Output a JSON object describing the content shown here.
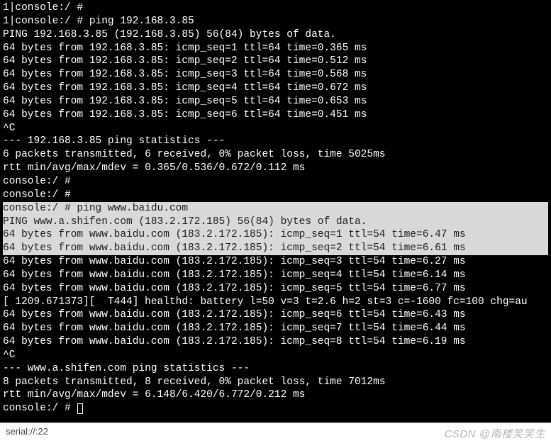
{
  "terminal": {
    "lines": [
      {
        "text": "1|console:/ #",
        "selected": false
      },
      {
        "text": "1|console:/ # ping 192.168.3.85",
        "selected": false
      },
      {
        "text": "PING 192.168.3.85 (192.168.3.85) 56(84) bytes of data.",
        "selected": false
      },
      {
        "text": "64 bytes from 192.168.3.85: icmp_seq=1 ttl=64 time=0.365 ms",
        "selected": false
      },
      {
        "text": "64 bytes from 192.168.3.85: icmp_seq=2 ttl=64 time=0.512 ms",
        "selected": false
      },
      {
        "text": "64 bytes from 192.168.3.85: icmp_seq=3 ttl=64 time=0.568 ms",
        "selected": false
      },
      {
        "text": "64 bytes from 192.168.3.85: icmp_seq=4 ttl=64 time=0.672 ms",
        "selected": false
      },
      {
        "text": "64 bytes from 192.168.3.85: icmp_seq=5 ttl=64 time=0.653 ms",
        "selected": false
      },
      {
        "text": "64 bytes from 192.168.3.85: icmp_seq=6 ttl=64 time=0.451 ms",
        "selected": false
      },
      {
        "text": "^C",
        "selected": false
      },
      {
        "text": "--- 192.168.3.85 ping statistics ---",
        "selected": false
      },
      {
        "text": "6 packets transmitted, 6 received, 0% packet loss, time 5025ms",
        "selected": false
      },
      {
        "text": "rtt min/avg/max/mdev = 0.365/0.536/0.672/0.112 ms",
        "selected": false
      },
      {
        "text": "console:/ #",
        "selected": false
      },
      {
        "text": "console:/ #",
        "selected": false
      },
      {
        "text": "console:/ # ping www.baidu.com",
        "selected": true
      },
      {
        "text": "PING www.a.shifen.com (183.2.172.185) 56(84) bytes of data.",
        "selected": true
      },
      {
        "text": "64 bytes from www.baidu.com (183.2.172.185): icmp_seq=1 ttl=54 time=6.47 ms",
        "selected": true
      },
      {
        "text": "64 bytes from www.baidu.com (183.2.172.185): icmp_seq=2 ttl=54 time=6.61 ms",
        "selected": true
      },
      {
        "text": "64 bytes from www.baidu.com (183.2.172.185): icmp_seq=3 ttl=54 time=6.27 ms",
        "selected": false
      },
      {
        "text": "64 bytes from www.baidu.com (183.2.172.185): icmp_seq=4 ttl=54 time=6.14 ms",
        "selected": false
      },
      {
        "text": "64 bytes from www.baidu.com (183.2.172.185): icmp_seq=5 ttl=54 time=6.77 ms",
        "selected": false
      },
      {
        "text": "[ 1209.671373][  T444] healthd: battery l=50 v=3 t=2.6 h=2 st=3 c=-1600 fc=100 chg=au",
        "selected": false
      },
      {
        "text": "64 bytes from www.baidu.com (183.2.172.185): icmp_seq=6 ttl=54 time=6.43 ms",
        "selected": false
      },
      {
        "text": "64 bytes from www.baidu.com (183.2.172.185): icmp_seq=7 ttl=54 time=6.44 ms",
        "selected": false
      },
      {
        "text": "64 bytes from www.baidu.com (183.2.172.185): icmp_seq=8 ttl=54 time=6.19 ms",
        "selected": false
      },
      {
        "text": "^C",
        "selected": false
      },
      {
        "text": "--- www.a.shifen.com ping statistics ---",
        "selected": false
      },
      {
        "text": "8 packets transmitted, 8 received, 0% packet loss, time 7012ms",
        "selected": false
      },
      {
        "text": "rtt min/avg/max/mdev = 6.148/6.420/6.772/0.212 ms",
        "selected": false
      }
    ],
    "prompt_final": "console:/ # "
  },
  "status": {
    "left": "serial://:22",
    "watermark": "CSDN @南楼笑笑生"
  }
}
